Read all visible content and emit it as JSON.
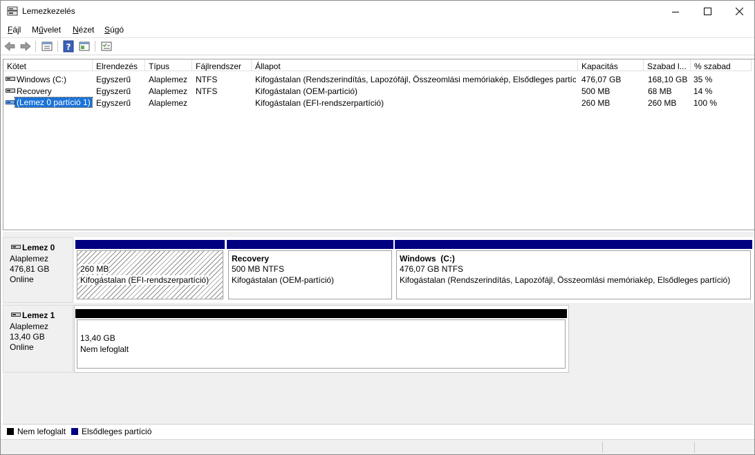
{
  "window": {
    "title": "Lemezkezelés"
  },
  "menu": [
    {
      "pre": "",
      "ul": "F",
      "post": "ájl"
    },
    {
      "pre": "M",
      "ul": "ű",
      "post": "velet"
    },
    {
      "pre": "",
      "ul": "N",
      "post": "ézet"
    },
    {
      "pre": "",
      "ul": "S",
      "post": "úgó"
    }
  ],
  "toolbar": {
    "icons": [
      "back-arrow-icon",
      "forward-arrow-icon",
      "properties-icon",
      "help-icon",
      "show-hide-console-icon",
      "action-pane-icon"
    ]
  },
  "table": {
    "columns": [
      "Kötet",
      "Elrendezés",
      "Típus",
      "Fájlrendszer",
      "Állapot",
      "Kapacitás",
      "Szabad l...",
      "% szabad"
    ],
    "rows": [
      {
        "volume": "Windows (C:)",
        "layout": "Egyszerű",
        "type": "Alaplemez",
        "fs": "NTFS",
        "status": "Kifogástalan (Rendszerindítás, Lapozófájl, Összeomlási memóriakép, Elsődleges partíc...",
        "capacity": "476,07 GB",
        "free": "168,10 GB",
        "pct": "35 %"
      },
      {
        "volume": "Recovery",
        "layout": "Egyszerű",
        "type": "Alaplemez",
        "fs": "NTFS",
        "status": "Kifogástalan (OEM-partíció)",
        "capacity": "500 MB",
        "free": "68 MB",
        "pct": "14 %"
      },
      {
        "volume": "(Lemez 0 partíció 1)",
        "layout": "Egyszerű",
        "type": "Alaplemez",
        "fs": "",
        "status": "Kifogástalan (EFI-rendszerpartíció)",
        "capacity": "260 MB",
        "free": "260 MB",
        "pct": "100 %"
      }
    ]
  },
  "disks": [
    {
      "name": "Lemez 0",
      "type": "Alaplemez",
      "size": "476,81 GB",
      "state": "Online",
      "partitions": [
        {
          "title": "",
          "size": "260 MB",
          "status": "Kifogástalan (EFI-rendszerpartíció)"
        },
        {
          "title": "Recovery",
          "size": "500 MB NTFS",
          "status": "Kifogástalan (OEM-partíció)"
        },
        {
          "title": "Windows  (C:)",
          "size": "476,07 GB NTFS",
          "status": "Kifogástalan (Rendszerindítás, Lapozófájl, Összeomlási memóriakép, Elsődleges partíció)"
        }
      ]
    },
    {
      "name": "Lemez 1",
      "type": "Alaplemez",
      "size": "13,40 GB",
      "state": "Online",
      "partitions": [
        {
          "title": "",
          "size": "13,40 GB",
          "status": "Nem lefoglalt"
        }
      ]
    }
  ],
  "legend": [
    {
      "label": "Nem lefoglalt",
      "color": "#000000"
    },
    {
      "label": "Elsődleges partíció",
      "color": "#000080"
    }
  ],
  "colors": {
    "primary": "#000080",
    "unallocated": "#000000",
    "selection": "#1a73d9"
  }
}
